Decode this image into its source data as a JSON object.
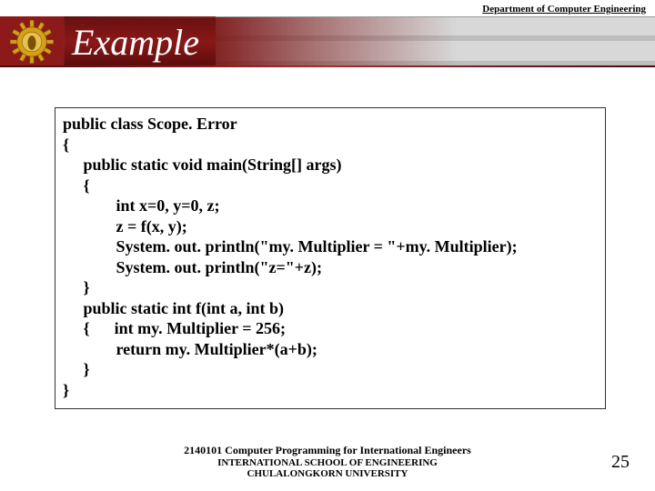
{
  "header": {
    "department": "Department of Computer Engineering",
    "title": "Example"
  },
  "code": {
    "lines": [
      "public class Scope. Error",
      "{",
      "     public static void main(String[] args)",
      "     {",
      "             int x=0, y=0, z;",
      "             z = f(x, y);",
      "             System. out. println(\"my. Multiplier = \"+my. Multiplier);",
      "             System. out. println(\"z=\"+z);",
      "     }",
      "     public static int f(int a, int b)",
      "     {      int my. Multiplier = 256;",
      "             return my. Multiplier*(a+b);",
      "     }",
      "}"
    ]
  },
  "footer": {
    "line1": "2140101 Computer Programming for International Engineers",
    "line2": "INTERNATIONAL SCHOOL OF ENGINEERING",
    "line3": "CHULALONGKORN UNIVERSITY"
  },
  "page_number": "25"
}
